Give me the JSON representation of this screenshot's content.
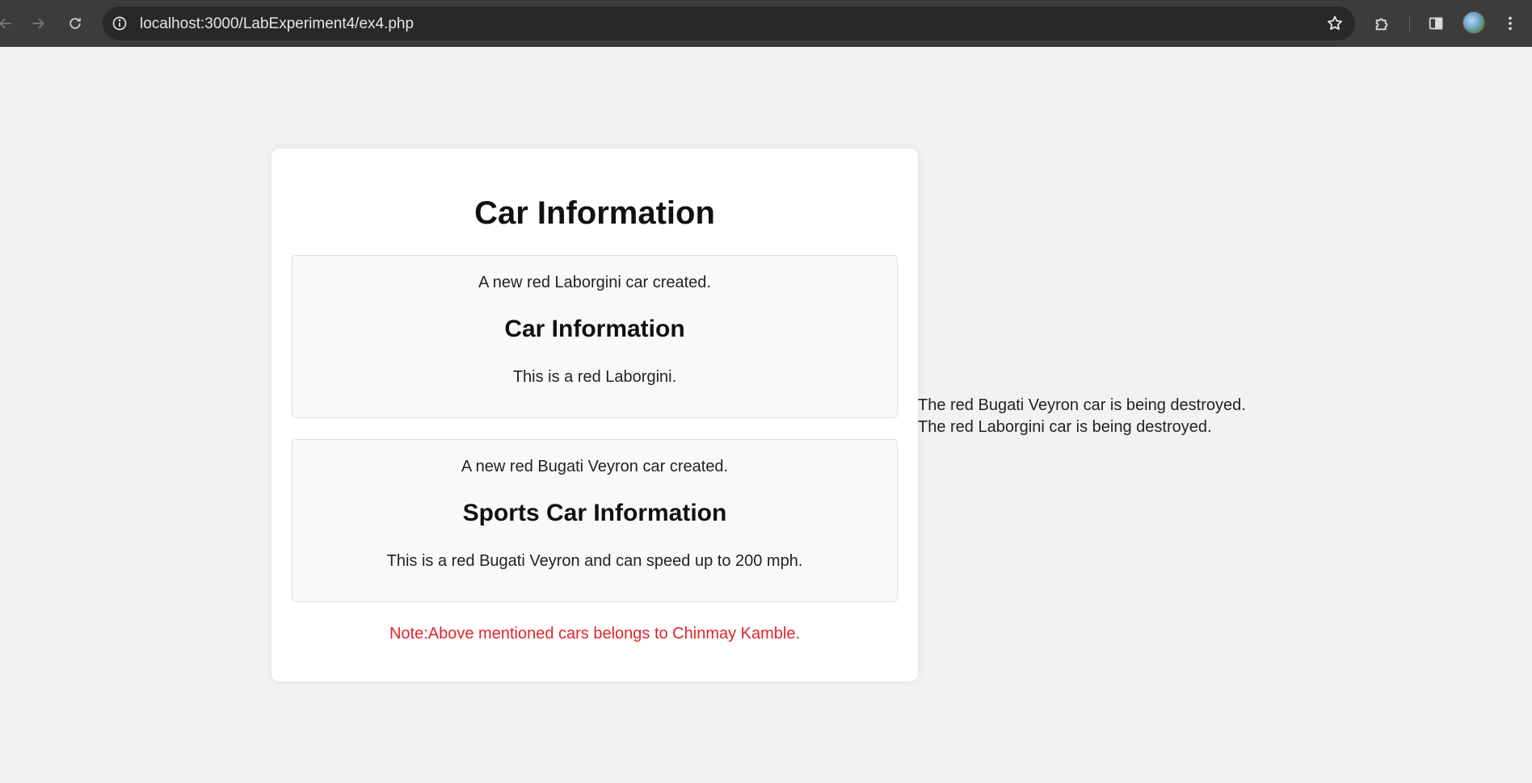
{
  "browser": {
    "url": "localhost:3000/LabExperiment4/ex4.php"
  },
  "card": {
    "title": "Car Information",
    "cars": [
      {
        "created_msg": "A new red Laborgini car created.",
        "heading": "Car Information",
        "description": "This is a red Laborgini."
      },
      {
        "created_msg": "A new red Bugati Veyron car created.",
        "heading": "Sports Car Information",
        "description": "This is a red Bugati Veyron and can speed up to 200 mph."
      }
    ],
    "note": "Note:Above mentioned cars belongs to Chinmay Kamble."
  },
  "destroy_messages": [
    "The red Bugati Veyron car is being destroyed.",
    "The red Laborgini car is being destroyed."
  ],
  "colors": {
    "note": "#e0242a",
    "page_bg": "#f2f2f2",
    "toolbar_bg": "#3c3c3c"
  }
}
